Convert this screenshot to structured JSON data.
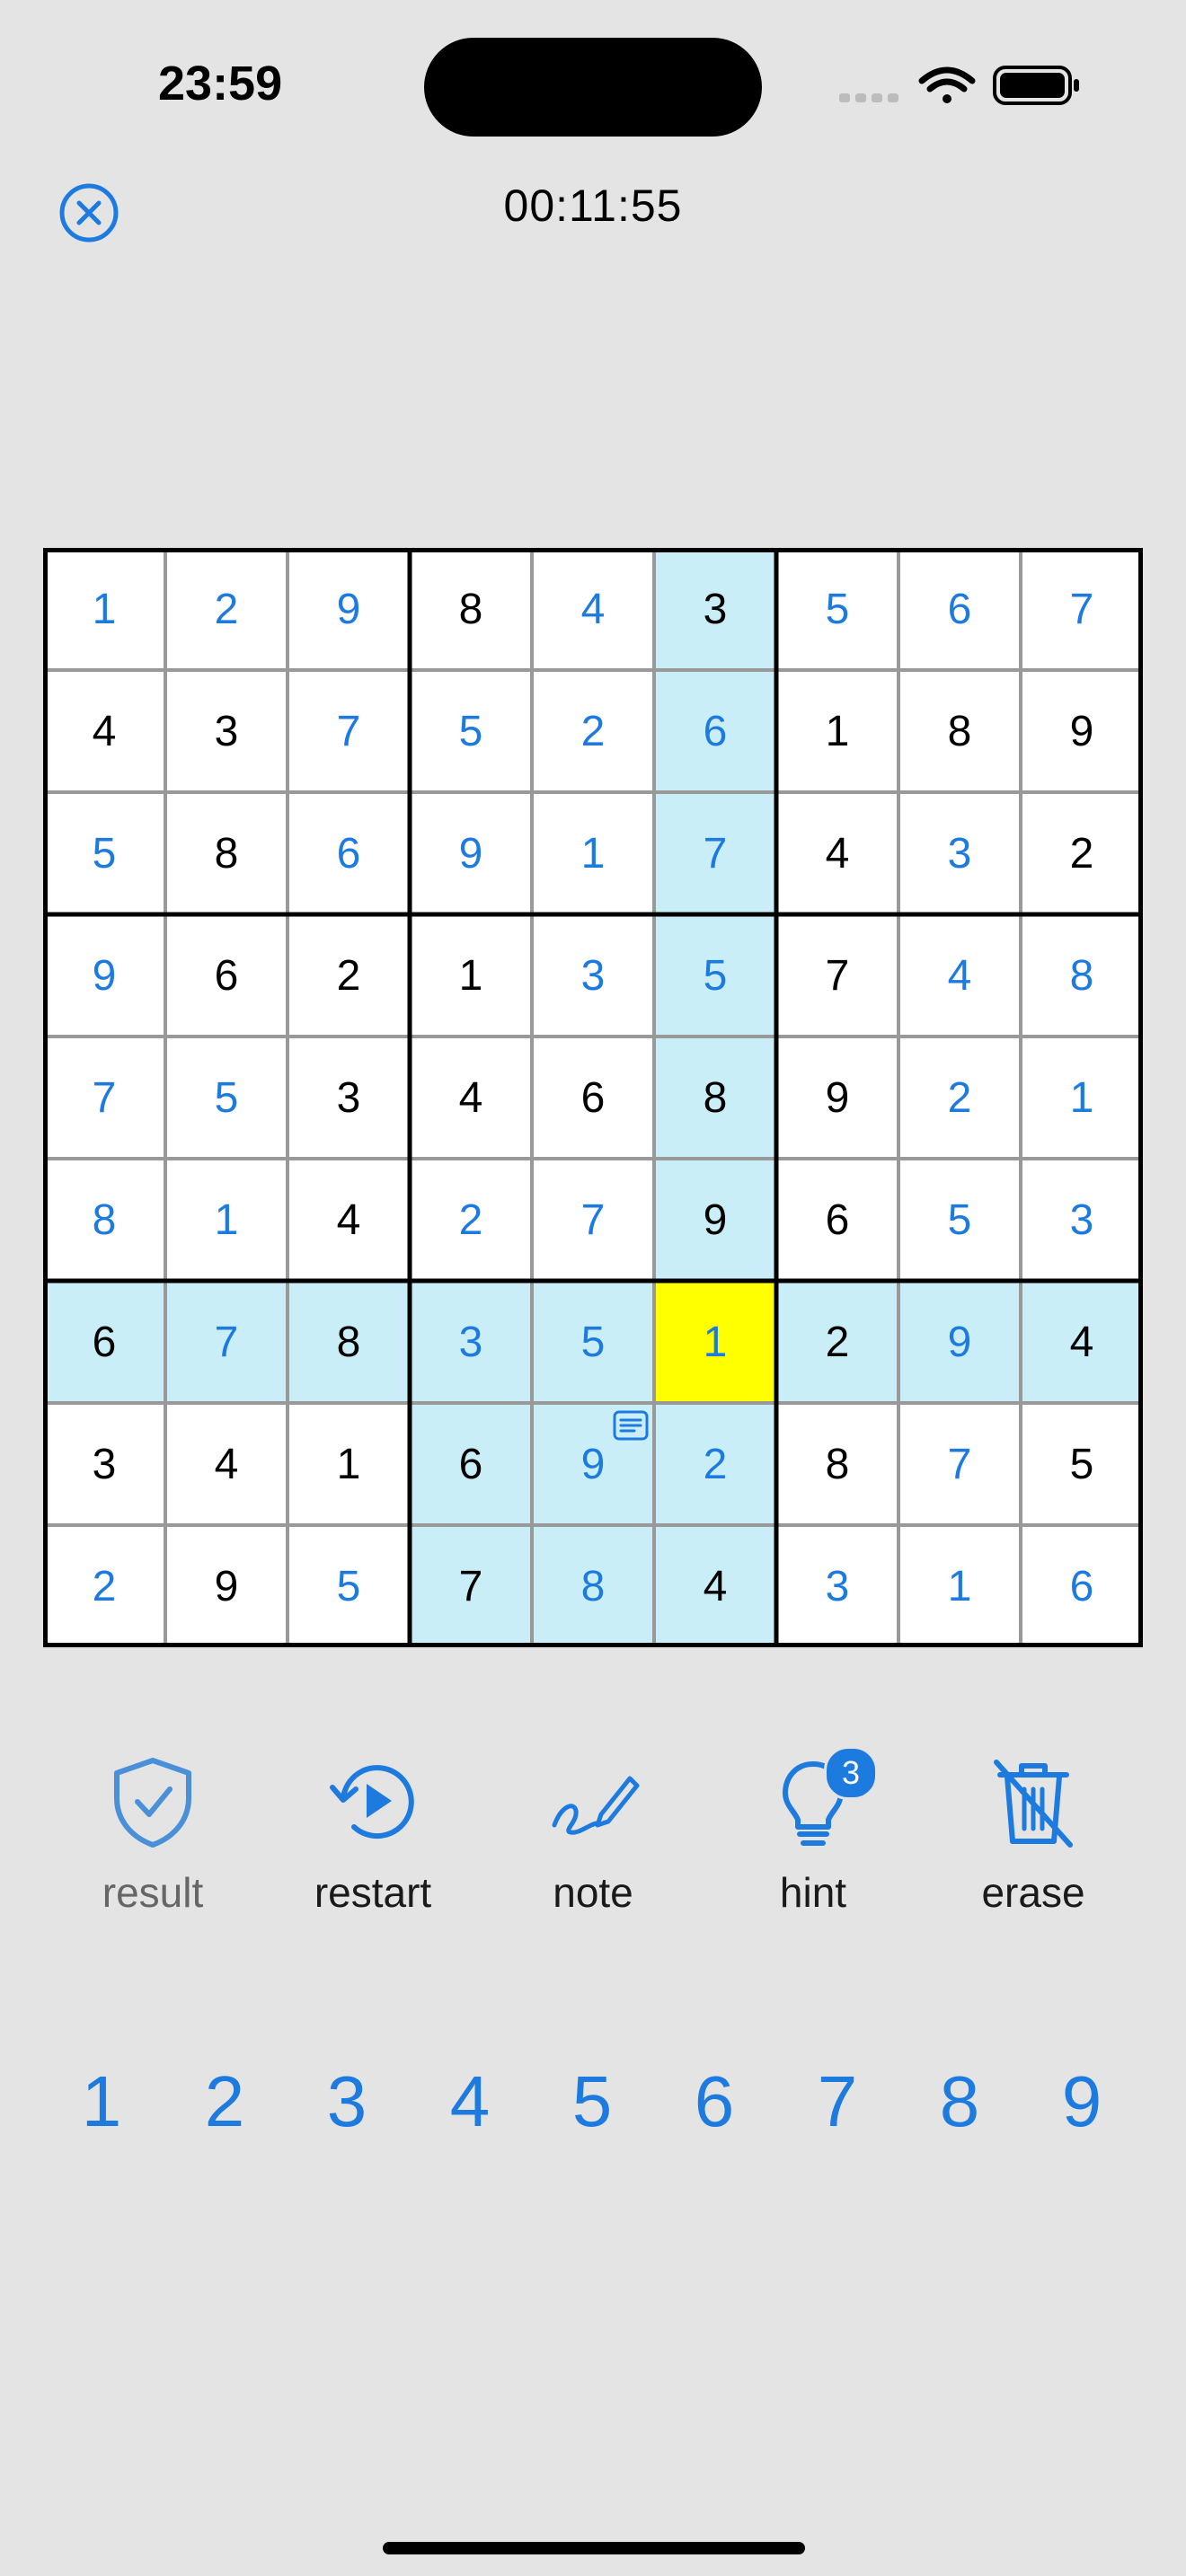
{
  "status": {
    "time": "23:59"
  },
  "header": {
    "timer": "00:11:55"
  },
  "board": {
    "rows": [
      [
        "1",
        "2",
        "9",
        "8",
        "4",
        "3",
        "5",
        "6",
        "7"
      ],
      [
        "4",
        "3",
        "7",
        "5",
        "2",
        "6",
        "1",
        "8",
        "9"
      ],
      [
        "5",
        "8",
        "6",
        "9",
        "1",
        "7",
        "4",
        "3",
        "2"
      ],
      [
        "9",
        "6",
        "2",
        "1",
        "3",
        "5",
        "7",
        "4",
        "8"
      ],
      [
        "7",
        "5",
        "3",
        "4",
        "6",
        "8",
        "9",
        "2",
        "1"
      ],
      [
        "8",
        "1",
        "4",
        "2",
        "7",
        "9",
        "6",
        "5",
        "3"
      ],
      [
        "6",
        "7",
        "8",
        "3",
        "5",
        "1",
        "2",
        "9",
        "4"
      ],
      [
        "3",
        "4",
        "1",
        "6",
        "9",
        "2",
        "8",
        "7",
        "5"
      ],
      [
        "2",
        "9",
        "5",
        "7",
        "8",
        "4",
        "3",
        "1",
        "6"
      ]
    ],
    "kinds": [
      "uuuguguuu",
      "gguuuuggg",
      "uguuuugug",
      "uggguuguu",
      "uugggggu u",
      "uuguuggu u",
      "gugu uugu g",
      "gggg uugug",
      "ugug uguuu"
    ],
    "selected": {
      "row": 6,
      "col": 5
    },
    "note_cell": {
      "row": 7,
      "col": 4
    },
    "colors": {
      "given": "#000000",
      "user": "#1d7be0",
      "highlight": "#c9eef7",
      "selected": "#ffff00"
    }
  },
  "tools": [
    {
      "id": "result",
      "label": "result",
      "icon": "shield-check-icon",
      "enabled": false
    },
    {
      "id": "restart",
      "label": "restart",
      "icon": "restart-icon",
      "enabled": true
    },
    {
      "id": "note",
      "label": "note",
      "icon": "pencil-icon",
      "enabled": true
    },
    {
      "id": "hint",
      "label": "hint",
      "icon": "lightbulb-icon",
      "enabled": true,
      "badge": "3"
    },
    {
      "id": "erase",
      "label": "erase",
      "icon": "trash-slash-icon",
      "enabled": true
    }
  ],
  "numpad": [
    "1",
    "2",
    "3",
    "4",
    "5",
    "6",
    "7",
    "8",
    "9"
  ]
}
